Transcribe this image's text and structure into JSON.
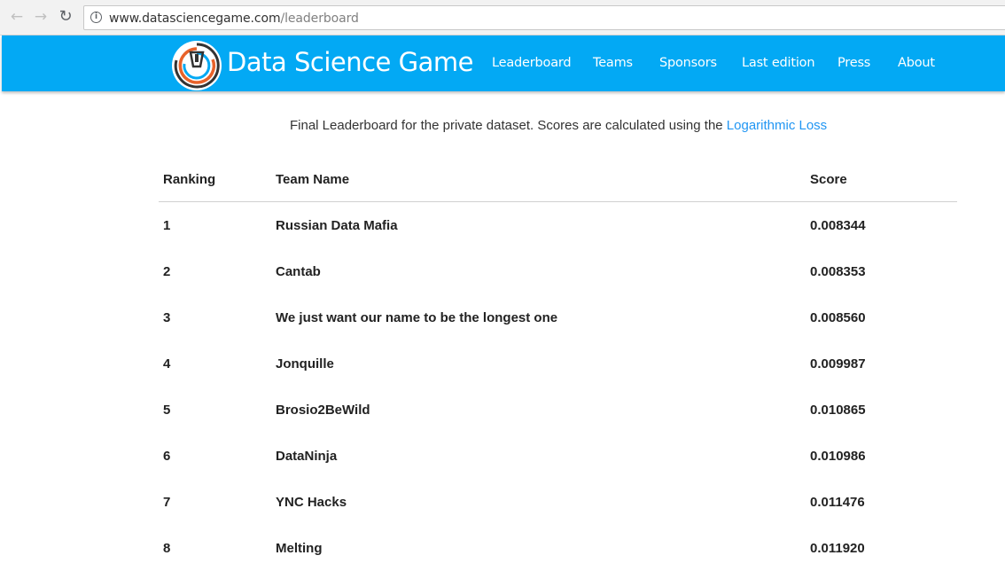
{
  "browser": {
    "url_host": "www.datasciencegame.com",
    "url_path": "/leaderboard",
    "icons": [
      "back-icon",
      "forward-icon",
      "reload-icon",
      "info-icon"
    ]
  },
  "site": {
    "brand": "Data Science Game",
    "header_color": "#03a9f4",
    "nav": [
      "Leaderboard",
      "Teams",
      "Sponsors",
      "Last edition",
      "Press",
      "About"
    ]
  },
  "intro": {
    "text": "Final Leaderboard for the private dataset. Scores are calculated using the ",
    "link": "Logarithmic Loss"
  },
  "table": {
    "headers": {
      "rank": "Ranking",
      "team": "Team Name",
      "score": "Score"
    },
    "rows": [
      {
        "rank": "1",
        "team": "Russian Data Mafia",
        "score": "0.008344"
      },
      {
        "rank": "2",
        "team": "Cantab",
        "score": "0.008353"
      },
      {
        "rank": "3",
        "team": "We just want our name to be the longest one",
        "score": "0.008560"
      },
      {
        "rank": "4",
        "team": "Jonquille",
        "score": "0.009987"
      },
      {
        "rank": "5",
        "team": "Brosio2BeWild",
        "score": "0.010865"
      },
      {
        "rank": "6",
        "team": "DataNinja",
        "score": "0.010986"
      },
      {
        "rank": "7",
        "team": "YNC Hacks",
        "score": "0.011476"
      },
      {
        "rank": "8",
        "team": "Melting",
        "score": "0.011920"
      }
    ]
  }
}
